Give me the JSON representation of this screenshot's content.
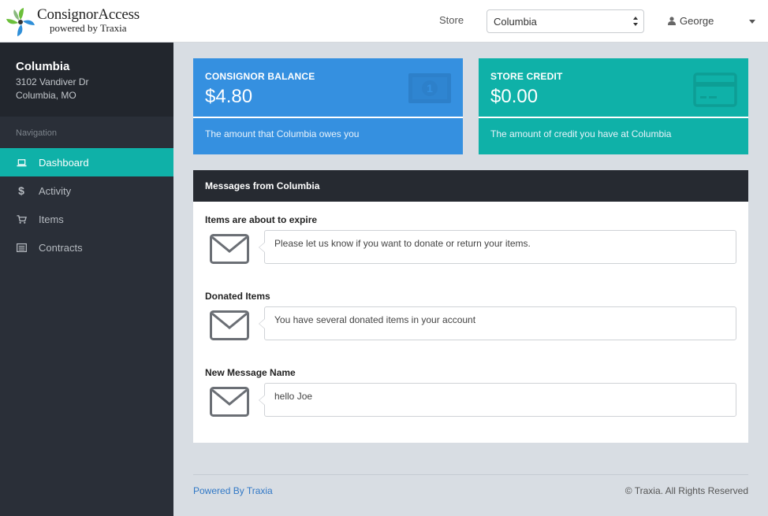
{
  "brand": {
    "name": "ConsignorAccess",
    "tagline": "powered by Traxia"
  },
  "header": {
    "store_label": "Store",
    "store_selected": "Columbia",
    "user_name": "George"
  },
  "sidebar": {
    "store_name": "Columbia",
    "address_line1": "3102 Vandiver Dr",
    "address_line2": "Columbia, MO",
    "nav_heading": "Navigation",
    "items": [
      {
        "label": "Dashboard",
        "icon": "laptop-icon",
        "active": true
      },
      {
        "label": "Activity",
        "icon": "dollar-icon",
        "active": false
      },
      {
        "label": "Items",
        "icon": "cart-icon",
        "active": false
      },
      {
        "label": "Contracts",
        "icon": "list-icon",
        "active": false
      }
    ]
  },
  "cards": {
    "balance": {
      "title": "Consignor Balance",
      "value": "$4.80",
      "description": "The amount that Columbia owes you",
      "icon": "money-bill-icon",
      "color": "#3590e0"
    },
    "credit": {
      "title": "Store Credit",
      "value": "$0.00",
      "description": "The amount of credit you have at Columbia",
      "icon": "credit-card-icon",
      "color": "#0fb1a8"
    }
  },
  "messages": {
    "title": "Messages from Columbia",
    "items": [
      {
        "title": "Items are about to expire",
        "body": "Please let us know if you want to donate or return your items.",
        "icon": "envelope-icon"
      },
      {
        "title": "Donated Items",
        "body": "You have several donated items in your account",
        "icon": "envelope-icon"
      },
      {
        "title": "New Message Name",
        "body": "hello Joe",
        "icon": "envelope-icon"
      }
    ]
  },
  "footer": {
    "left": "Powered By Traxia",
    "right": "© Traxia. All Rights Reserved"
  }
}
